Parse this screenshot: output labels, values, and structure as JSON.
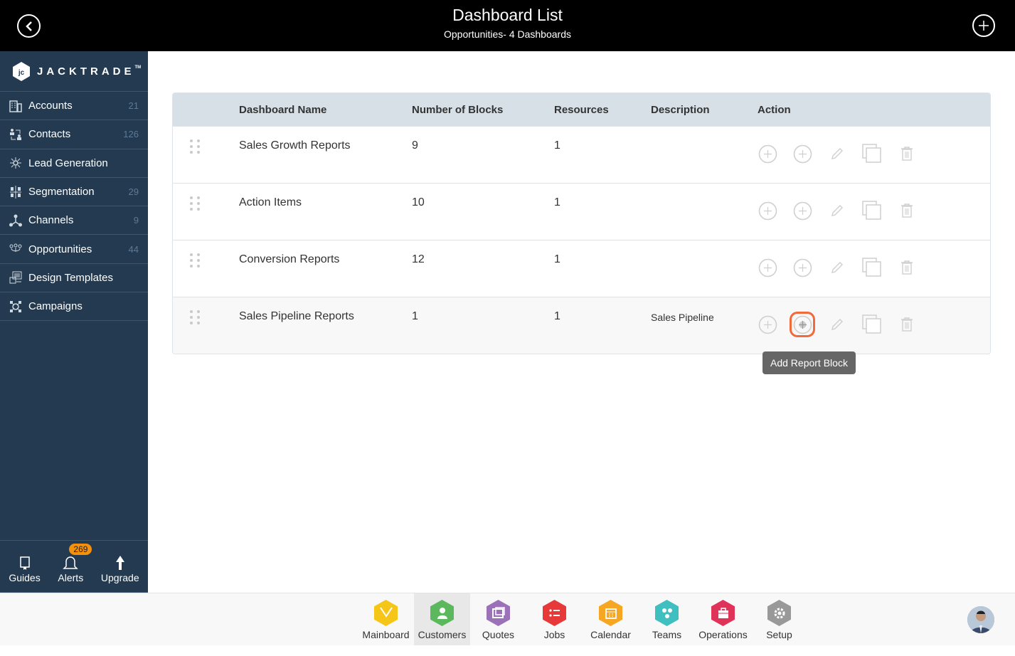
{
  "header": {
    "title": "Dashboard List",
    "subtitle": "Opportunities- 4 Dashboards"
  },
  "sidebar": {
    "logo_text": "JACKTRADE",
    "logo_tm": "TM",
    "items": [
      {
        "label": "Accounts",
        "count": "21",
        "icon": "building-icon"
      },
      {
        "label": "Contacts",
        "count": "126",
        "icon": "contacts-icon"
      },
      {
        "label": "Lead Generation",
        "count": "",
        "icon": "lead-generation-icon"
      },
      {
        "label": "Segmentation",
        "count": "29",
        "icon": "segmentation-icon"
      },
      {
        "label": "Channels",
        "count": "9",
        "icon": "channels-icon"
      },
      {
        "label": "Opportunities",
        "count": "44",
        "icon": "opportunities-icon"
      },
      {
        "label": "Design Templates",
        "count": "",
        "icon": "design-templates-icon"
      },
      {
        "label": "Campaigns",
        "count": "",
        "icon": "campaigns-icon"
      }
    ],
    "tools": [
      {
        "label": "Guides"
      },
      {
        "label": "Alerts",
        "badge": "269"
      },
      {
        "label": "Upgrade"
      }
    ],
    "quick_icons": [
      "user-icon",
      "dollar-icon",
      "money-icon",
      "workflow-icon"
    ]
  },
  "table": {
    "columns": [
      "Dashboard Name",
      "Number of Blocks",
      "Resources",
      "Description",
      "Action"
    ],
    "rows": [
      {
        "name": "Sales Growth Reports",
        "blocks": "9",
        "resources": "1",
        "description": ""
      },
      {
        "name": "Action Items",
        "blocks": "10",
        "resources": "1",
        "description": ""
      },
      {
        "name": "Conversion Reports",
        "blocks": "12",
        "resources": "1",
        "description": ""
      },
      {
        "name": "Sales Pipeline Reports",
        "blocks": "1",
        "resources": "1",
        "description": "Sales Pipeline"
      }
    ],
    "tooltip": "Add Report Block"
  },
  "bottom_nav": {
    "apps": [
      {
        "label": "Mainboard",
        "color": "#f5c518"
      },
      {
        "label": "Customers",
        "color": "#5cb85c",
        "active": true
      },
      {
        "label": "Quotes",
        "color": "#9b72b8"
      },
      {
        "label": "Jobs",
        "color": "#e8393a"
      },
      {
        "label": "Calendar",
        "color": "#f5a623"
      },
      {
        "label": "Teams",
        "color": "#3fbfbf"
      },
      {
        "label": "Operations",
        "color": "#e0335a"
      },
      {
        "label": "Setup",
        "color": "#999999"
      }
    ]
  },
  "colors": {
    "sidebar_bg": "#233a50",
    "highlight": "#f26a3a",
    "badge": "#f4900c",
    "quick_icon": "#4fb8b8"
  }
}
